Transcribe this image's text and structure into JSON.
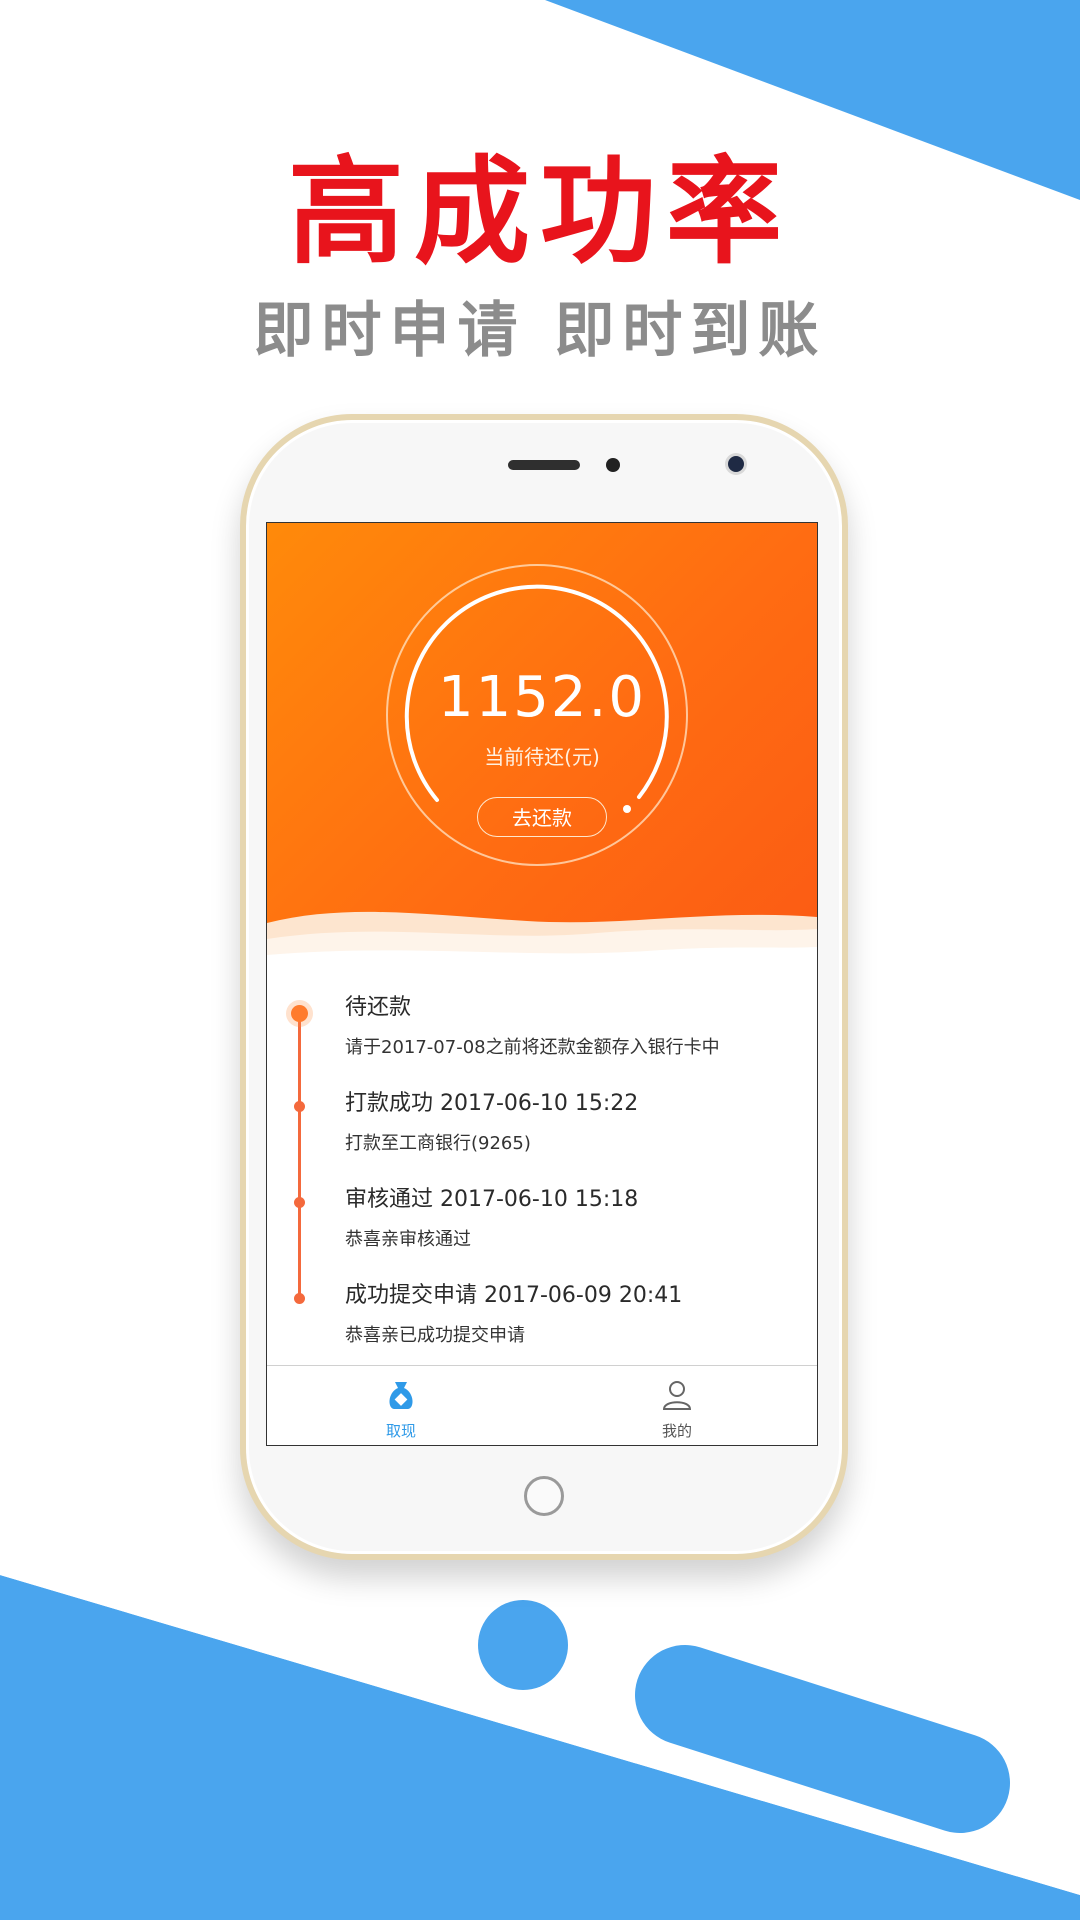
{
  "promo": {
    "headline": "高成功率",
    "subline": "即时申请  即时到账"
  },
  "colors": {
    "accent_blue": "#4aa5ee",
    "headline_red": "#e8141c",
    "hero_orange": "#ff7a10",
    "timeline_orange": "#f4693c"
  },
  "app": {
    "balance": {
      "amount": "1152.0",
      "label": "当前待还(元)",
      "button": "去还款"
    },
    "timeline": [
      {
        "title": "待还款",
        "desc": "请于2017-07-08之前将还款金额存入银行卡中"
      },
      {
        "title": "打款成功 2017-06-10 15:22",
        "desc": "打款至工商银行(9265)"
      },
      {
        "title": "审核通过 2017-06-10 15:18",
        "desc": "恭喜亲审核通过"
      },
      {
        "title": "成功提交申请 2017-06-09 20:41",
        "desc": "恭喜亲已成功提交申请"
      }
    ],
    "tabs": [
      {
        "label": "取现",
        "icon": "money-bag-icon",
        "active": true
      },
      {
        "label": "我的",
        "icon": "user-icon",
        "active": false
      }
    ]
  }
}
